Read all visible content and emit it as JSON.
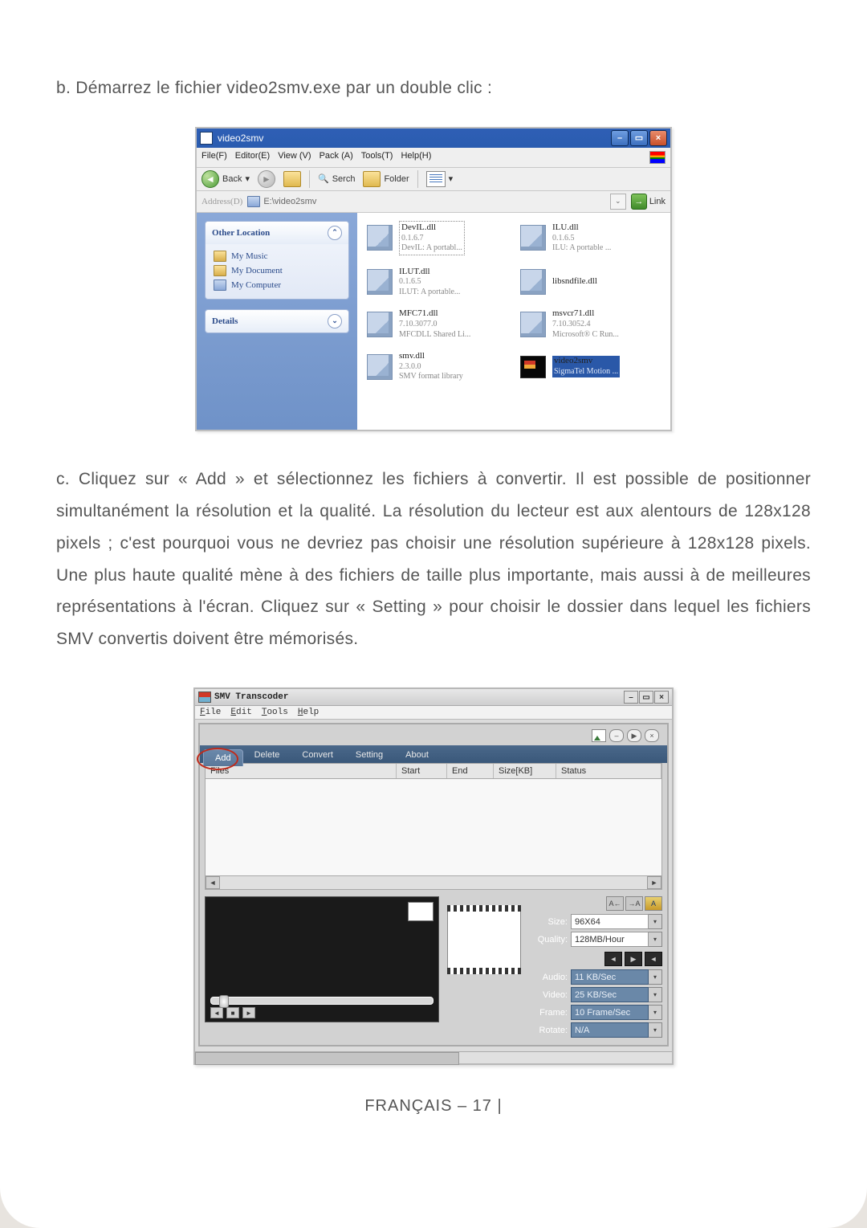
{
  "doc": {
    "step_b": "b. Démarrez le fichier video2smv.exe par un double clic :",
    "step_c": "c. Cliquez sur « Add » et sélectionnez les fichiers à convertir. Il est possible de positionner simultanément la résolution et la qualité. La résolution du lecteur est aux alentours de 128x128 pixels ; c'est pourquoi vous ne devriez pas choisir une résolution supérieure à 128x128 pixels. Une plus haute qualité mène à des fichiers de taille plus importante, mais aussi à de meilleures représentations à l'écran. Cliquez sur « Setting » pour choisir le dossier dans lequel les fichiers SMV convertis doivent être mémorisés.",
    "footer": "FRANÇAIS – 17  |"
  },
  "explorer": {
    "title": "video2smv",
    "menubar": {
      "file": "File(F)",
      "editor": "Editor(E)",
      "view": "View (V)",
      "pack": "Pack (A)",
      "tools": "Tools(T)",
      "help": "Help(H)"
    },
    "toolbar": {
      "back": "Back",
      "search": "Serch",
      "folder": "Folder"
    },
    "address": {
      "label": "Address(D)",
      "path": "E:\\video2smv",
      "go": "Link"
    },
    "sidebar": {
      "other_location": "Other Location",
      "items": [
        "My Music",
        "My Document",
        "My Computer"
      ],
      "details": "Details"
    },
    "files": [
      {
        "name": "DevIL.dll",
        "ver": "0.1.6.7",
        "desc": "DevIL: A portabl..."
      },
      {
        "name": "ILU.dll",
        "ver": "0.1.6.5",
        "desc": "ILU: A portable ..."
      },
      {
        "name": "ILUT.dll",
        "ver": "0.1.6.5",
        "desc": "ILUT: A portable..."
      },
      {
        "name": "libsndfile.dll",
        "ver": "",
        "desc": ""
      },
      {
        "name": "MFC71.dll",
        "ver": "7.10.3077.0",
        "desc": "MFCDLL Shared Li..."
      },
      {
        "name": "msvcr71.dll",
        "ver": "7.10.3052.4",
        "desc": "Microsoft® C Run..."
      },
      {
        "name": "smv.dll",
        "ver": "2.3.0.0",
        "desc": "SMV format library"
      },
      {
        "name": "video2smv",
        "ver": "",
        "desc": "SigmaTel Motion ..."
      }
    ]
  },
  "transcoder": {
    "title": "SMV Transcoder",
    "menubar": {
      "file": "File",
      "edit": "Edit",
      "tools": "Tools",
      "help": "Help"
    },
    "tabs": {
      "add": "Add",
      "delete": "Delete",
      "convert": "Convert",
      "setting": "Setting",
      "about": "About"
    },
    "columns": {
      "files": "Files",
      "start": "Start",
      "end": "End",
      "size": "Size[KB]",
      "status": "Status"
    },
    "top_icons": {
      "prev": "–",
      "play": "▶",
      "close": "×"
    },
    "params": {
      "top": {
        "a": "A←",
        "b": "→A",
        "c": "A"
      },
      "size": {
        "label": "Size:",
        "value": "96X64"
      },
      "quality": {
        "label": "Quality:",
        "value": "128MB/Hour"
      },
      "audio": {
        "label": "Audio:",
        "value": "11 KB/Sec"
      },
      "video": {
        "label": "Video:",
        "value": "25 KB/Sec"
      },
      "frame": {
        "label": "Frame:",
        "value": "10 Frame/Sec"
      },
      "rotate": {
        "label": "Rotate:",
        "value": "N/A"
      },
      "sound": {
        "l": "◄",
        "c": "▶",
        "r": "◄"
      }
    }
  }
}
